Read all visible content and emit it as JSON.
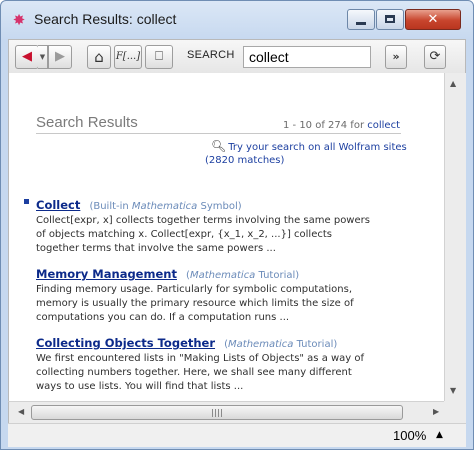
{
  "window": {
    "title": "Search Results: collect",
    "close_glyph": "✕"
  },
  "toolbar": {
    "back_glyph": "◀",
    "back_menu_glyph": "▼",
    "forward_glyph": "▶",
    "home_glyph": "⌂",
    "function_glyph": "F[...]",
    "book_glyph": "⎕",
    "search_label": "SEARCH",
    "search_value": "collect",
    "go_glyph": "»",
    "refresh_glyph": "⟳"
  },
  "results_page": {
    "heading": "Search Results",
    "range_text": "1 - 10 of 274 for",
    "range_term": "collect",
    "wolfram_link": "Try your search on all Wolfram sites",
    "match_count": "(2820 matches)"
  },
  "results": [
    {
      "title": "Collect",
      "kind_prefix": "(Built-in ",
      "kind_italic": "Mathematica",
      "kind_suffix": " Symbol)",
      "lines": [
        "Collect[expr, x] collects together terms involving the same powers",
        "of objects matching x. Collect[expr, {x_1, x_2, ...}] collects",
        "together terms that involve the same powers ..."
      ]
    },
    {
      "title": "Memory Management",
      "kind_prefix": "(",
      "kind_italic": "Mathematica",
      "kind_suffix": " Tutorial)",
      "lines": [
        "Finding memory usage. Particularly for symbolic computations,",
        "memory is usually the primary resource which limits the size of",
        "computations you can do. If a computation runs ..."
      ]
    },
    {
      "title": "Collecting Objects Together",
      "kind_prefix": "(",
      "kind_italic": "Mathematica",
      "kind_suffix": " Tutorial)",
      "lines": [
        "We first encountered lists in \"Making Lists of Objects\" as a way of",
        "collecting numbers together. Here, we shall see many different",
        "ways to use lists. You will find that lists ..."
      ]
    }
  ],
  "status": {
    "zoom": "100%",
    "zoom_arrow": "▲"
  },
  "icons": {
    "app": "mathematica-star-icon",
    "search": "magnifier-icon"
  }
}
